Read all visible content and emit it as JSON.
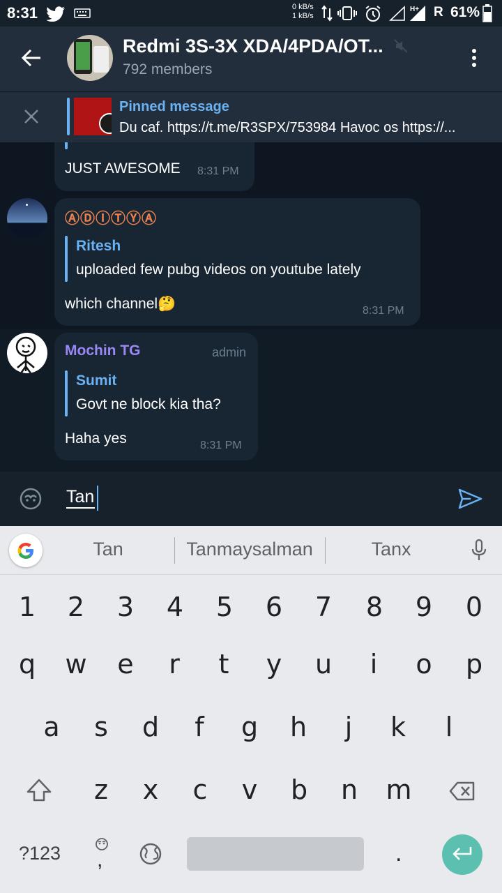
{
  "status": {
    "time": "8:31",
    "net_up": "0 kB/s",
    "net_down": "1 kB/s",
    "roaming": "R",
    "battery": "61%"
  },
  "header": {
    "title": "Redmi 3S-3X XDA/4PDA/OT...",
    "members": "792 members"
  },
  "pinned": {
    "title": "Pinned message",
    "text": "Du caf. https://t.me/R3SPX/753984 Havoc os https://..."
  },
  "messages": {
    "m1": {
      "text": "JUST AWESOME",
      "time": "8:31 PM"
    },
    "m2": {
      "sender": "ⒶⒹⒾⓉⓎⒶ",
      "reply_name": "Ritesh",
      "reply_text": "uploaded few pubg videos on youtube lately",
      "text": "which channel🤔",
      "time": "8:31 PM"
    },
    "m3": {
      "sender": "Mochin TG",
      "role": "admin",
      "reply_name": "Sumit",
      "reply_text": "Govt ne block kia tha?",
      "text": "Haha yes",
      "time": "8:31 PM"
    }
  },
  "composer": {
    "value": "Tan"
  },
  "keyboard": {
    "suggestions": [
      "Tan",
      "Tanmaysalman",
      "Tanx"
    ],
    "row_numbers": [
      "1",
      "2",
      "3",
      "4",
      "5",
      "6",
      "7",
      "8",
      "9",
      "0"
    ],
    "row1": [
      "q",
      "w",
      "e",
      "r",
      "t",
      "y",
      "u",
      "i",
      "o",
      "p"
    ],
    "row2": [
      "a",
      "s",
      "d",
      "f",
      "g",
      "h",
      "j",
      "k",
      "l"
    ],
    "row3": [
      "z",
      "x",
      "c",
      "v",
      "b",
      "n",
      "m"
    ],
    "symbols_label": "?123",
    "comma": ",",
    "period": "."
  },
  "colors": {
    "accent": "#6ab2f2",
    "chat_bg": "#0e1621",
    "bubble": "#182533",
    "admin_name": "#9b87f5",
    "aditya_name": "#e9824f",
    "enter_key": "#5bc0b0"
  }
}
